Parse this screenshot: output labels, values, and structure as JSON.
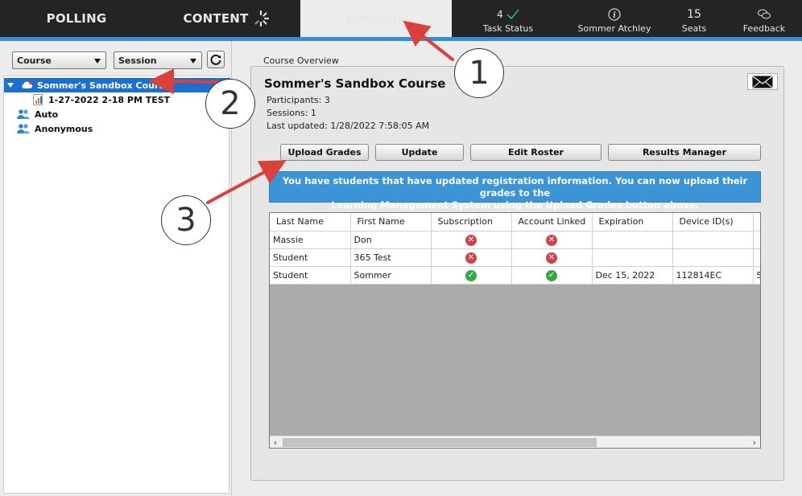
{
  "nav": {
    "tabs": [
      {
        "label": "POLLING"
      },
      {
        "label": "CONTENT"
      },
      {
        "label": "MANAGE"
      }
    ],
    "task_status": {
      "count": "4",
      "label": "Task Status"
    },
    "user": {
      "name": "Sommer Atchley"
    },
    "seats": {
      "count": "15",
      "label": "Seats"
    },
    "feedback": {
      "label": "Feedback"
    }
  },
  "left": {
    "course_dropdown": "Course",
    "session_dropdown": "Session",
    "tree": {
      "course": "Sommer's Sandbox Course",
      "session": "1-27-2022 2-18 PM TEST",
      "groups": [
        "Auto",
        "Anonymous"
      ]
    }
  },
  "overview": {
    "section_label": "Course Overview",
    "title": "Sommer's Sandbox Course",
    "participants": "Participants: 3",
    "sessions": "Sessions: 1",
    "last_updated": "Last updated: 1/28/2022 7:58:05 AM",
    "buttons": {
      "upload": "Upload Grades",
      "update": "Update",
      "edit_roster": "Edit Roster",
      "results": "Results Manager"
    },
    "banner_line1": "You have students that have updated registration information. You can now upload their grades to the",
    "banner_line2": "Learning Management System using the Upload Grades button above."
  },
  "grid": {
    "columns": [
      "Last Name",
      "First Name",
      "Subscription",
      "Account Linked",
      "Expiration",
      "Device ID(s)"
    ],
    "rows": [
      {
        "last": "Massie",
        "first": "Don",
        "subscription": "x",
        "linked": "x",
        "expiration": "",
        "device": "",
        "extra": ""
      },
      {
        "last": "Student",
        "first": "365 Test",
        "subscription": "x",
        "linked": "x",
        "expiration": "",
        "device": "",
        "extra": ""
      },
      {
        "last": "Student",
        "first": "Sommer",
        "subscription": "ok",
        "linked": "ok",
        "expiration": "Dec 15, 2022",
        "device": "112814EC",
        "extra": "S"
      }
    ]
  },
  "annotations": {
    "one": "1",
    "two": "2",
    "three": "3"
  },
  "colors": {
    "accent_blue": "#2f8fd8",
    "selection_blue": "#1a6fd0",
    "banner_blue": "#3a94d6",
    "arrow_red": "#d9413a",
    "error_red": "#d0434a",
    "ok_green": "#3aa64b"
  }
}
